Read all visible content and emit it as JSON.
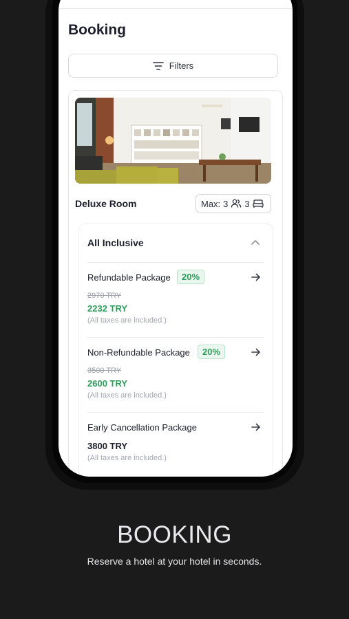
{
  "page": {
    "title": "Booking"
  },
  "filters": {
    "label": "Filters",
    "icon": "filter-lines-icon"
  },
  "room": {
    "name": "Deluxe Room",
    "capacity": {
      "max_label": "Max:",
      "guests": "3",
      "beds": "3"
    }
  },
  "board": {
    "title": "All Inclusive",
    "expanded": true
  },
  "packages": [
    {
      "name": "Refundable Package",
      "discount": "20%",
      "old_price": "2970 TRY",
      "price": "2232 TRY",
      "tax_note": "(All taxes are included.)"
    },
    {
      "name": "Non-Refundable Package",
      "discount": "20%",
      "old_price": "3500 TRY",
      "price": "2600 TRY",
      "tax_note": "(All taxes are included.)"
    },
    {
      "name": "Early Cancellation Package",
      "price": "3800 TRY",
      "tax_note": "(All taxes are included.)"
    }
  ],
  "promo": {
    "headline": "BOOKING",
    "subtitle": "Reserve a hotel at your hotel in seconds."
  },
  "colors": {
    "background": "#1b1b1b",
    "accent_green": "#2e9d5b",
    "badge_bg": "#eaf7ef",
    "text_dark": "#1c1f2b"
  }
}
